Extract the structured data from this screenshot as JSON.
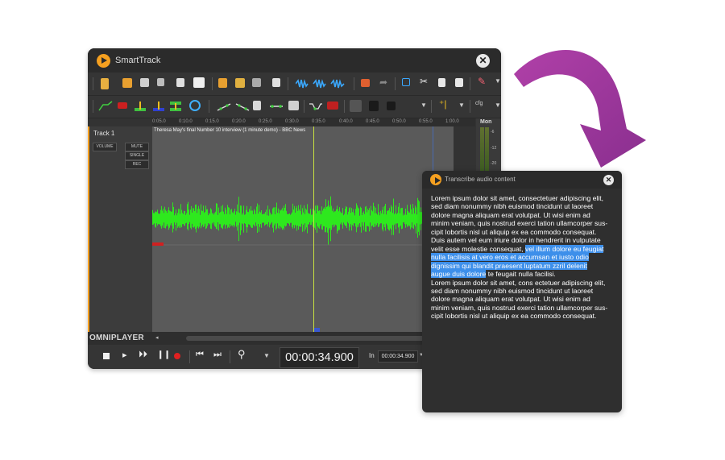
{
  "main_window": {
    "title": "SmartTrack",
    "timeline_ticks": [
      "0:05.0",
      "0:10.0",
      "0:15.0",
      "0:20.0",
      "0:25.0",
      "0:30.0",
      "0:35.0",
      "0:40.0",
      "0:45.0",
      "0:50.0",
      "0:55.0",
      "1:00.0"
    ],
    "meter_label": "Mon",
    "meter_values": [
      "-6",
      "-12",
      "-20"
    ],
    "track": {
      "name": "Track 1",
      "volume_label": "VOLUME",
      "mute_label": "MUTE",
      "single_label": "SINGLE",
      "rec_label": "REC",
      "clip_title": "Theresa May's final Number 10 interview (1 minute demo) - BBC News"
    },
    "player": {
      "brand": "OMNIPLAYER",
      "timecode": "00:00:34.900",
      "in_label": "In",
      "in_value": "00:00:34.900"
    },
    "colors": {
      "waveform": "#2ee81e",
      "playhead": "#c8e040",
      "accent": "#f5a020"
    }
  },
  "transcribe_window": {
    "title": "Transcribe audio content",
    "lines": [
      {
        "text": "Lorem ipsum dolor sit amet, consectetuer adipiscing elit,",
        "highlight": ""
      },
      {
        "text": "sed diam nonummy nibh euismod tincidunt ut laoreet",
        "highlight": ""
      },
      {
        "text": "dolore magna aliquam erat volutpat. Ut wisi enim ad",
        "highlight": ""
      },
      {
        "text": "minim veniam, quis nostrud exerci tation ullamcorper sus-",
        "highlight": ""
      },
      {
        "text": "cipit lobortis nisl ut aliquip ex ea commodo consequat.",
        "highlight": ""
      },
      {
        "text": "Duis autem vel eum iriure dolor in hendrerit in vulputate",
        "highlight": ""
      },
      {
        "text": "velit esse molestie consequat, ",
        "highlight": "vel illum dolore eu feugiat"
      },
      {
        "text": "",
        "highlight": "nulla facilisis at vero eros et accumsan et iusto odio"
      },
      {
        "text": "",
        "highlight": "dignissim qui blandit praesent luptatum zzril delenit"
      },
      {
        "text": "",
        "highlight": "augue duis dolore",
        "after": " te feugait nulla facilisi."
      },
      {
        "text": "Lorem ipsum dolor sit amet, cons ectetuer adipiscing elit,",
        "highlight": ""
      },
      {
        "text": "sed diam nonummy nibh euismod tincidunt ut laoreet",
        "highlight": ""
      },
      {
        "text": "dolore magna aliquam erat volutpat. Ut wisi enim ad",
        "highlight": ""
      },
      {
        "text": "minim veniam, quis nostrud exerci tation ullamcorper sus-",
        "highlight": ""
      },
      {
        "text": "cipit lobortis nisl ut aliquip ex ea commodo consequat.",
        "highlight": ""
      }
    ],
    "highlight_color": "#3d8fea"
  },
  "arrow_color": "#a8399e"
}
